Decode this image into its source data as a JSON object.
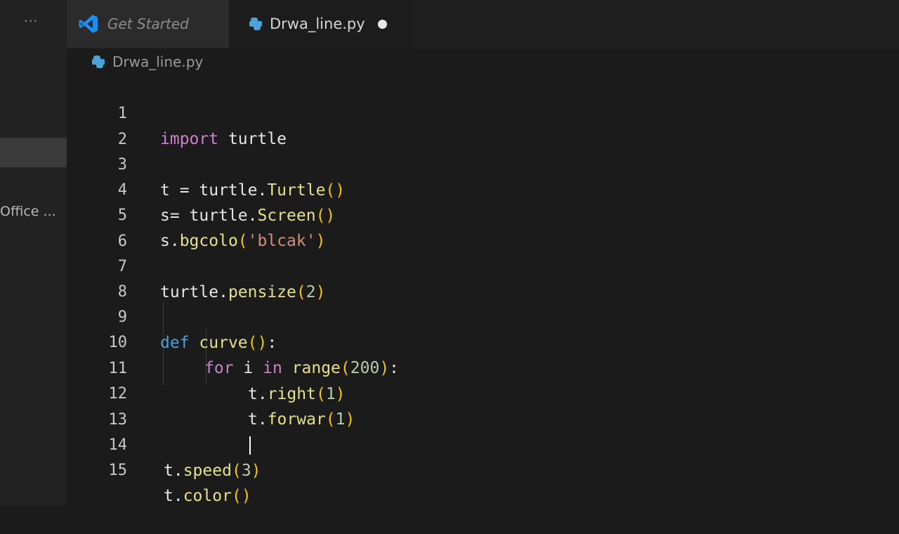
{
  "sidebar": {
    "more": "···",
    "office_label": "Office ..."
  },
  "tabs": [
    {
      "label": "Get Started",
      "icon": "vscode-logo-icon"
    },
    {
      "label": "Drwa_line.py",
      "icon": "python-icon",
      "dirty": true
    }
  ],
  "breadcrumb": {
    "file": "Drwa_line.py",
    "icon": "python-icon"
  },
  "colors": {
    "accent_blue": "#1b8ff2",
    "python_blue": "#4aa3d8"
  },
  "code": {
    "lines": [
      {
        "n": "1"
      },
      {
        "n": "2"
      },
      {
        "n": "3"
      },
      {
        "n": "4"
      },
      {
        "n": "5"
      },
      {
        "n": "6"
      },
      {
        "n": "7"
      },
      {
        "n": "8"
      },
      {
        "n": "9"
      },
      {
        "n": "10"
      },
      {
        "n": "11"
      },
      {
        "n": "12"
      },
      {
        "n": "13"
      },
      {
        "n": "14"
      },
      {
        "n": "15"
      }
    ],
    "t1": {
      "kw": "import",
      "rest": " turtle"
    },
    "t3": {
      "a": "t = turtle.",
      "b": "Turtle",
      "p": "()"
    },
    "t4": {
      "a": "s= turtle.",
      "b": "Screen",
      "p": "()"
    },
    "t5": {
      "a": "s.",
      "b": "bgcolo",
      "p1": "(",
      "s": "'blcak'",
      "p2": ")"
    },
    "t7": {
      "a": "turtle.",
      "b": "pensize",
      "p1": "(",
      "n": "2",
      "p2": ")"
    },
    "t9": {
      "kw": "def",
      "sp": " ",
      "b": "curve",
      "p": "()",
      "c": ":"
    },
    "t10": {
      "kw1": "for",
      "v": " i ",
      "kw2": "in",
      "sp": " ",
      "b": "range",
      "p1": "(",
      "n": "200",
      "p2": ")",
      "c": ":"
    },
    "t11": {
      "a": "t.",
      "b": "right",
      "p1": "(",
      "n": "1",
      "p2": ")"
    },
    "t12": {
      "a": "t.",
      "b": "forwar",
      "p1": "(",
      "n": "1",
      "p2": ")"
    },
    "t14": {
      "a": "t.",
      "b": "speed",
      "p1": "(",
      "n": "3",
      "p2": ")"
    },
    "t15": {
      "a": "t.",
      "b": "color",
      "p1": "(",
      "p2": ")"
    }
  }
}
